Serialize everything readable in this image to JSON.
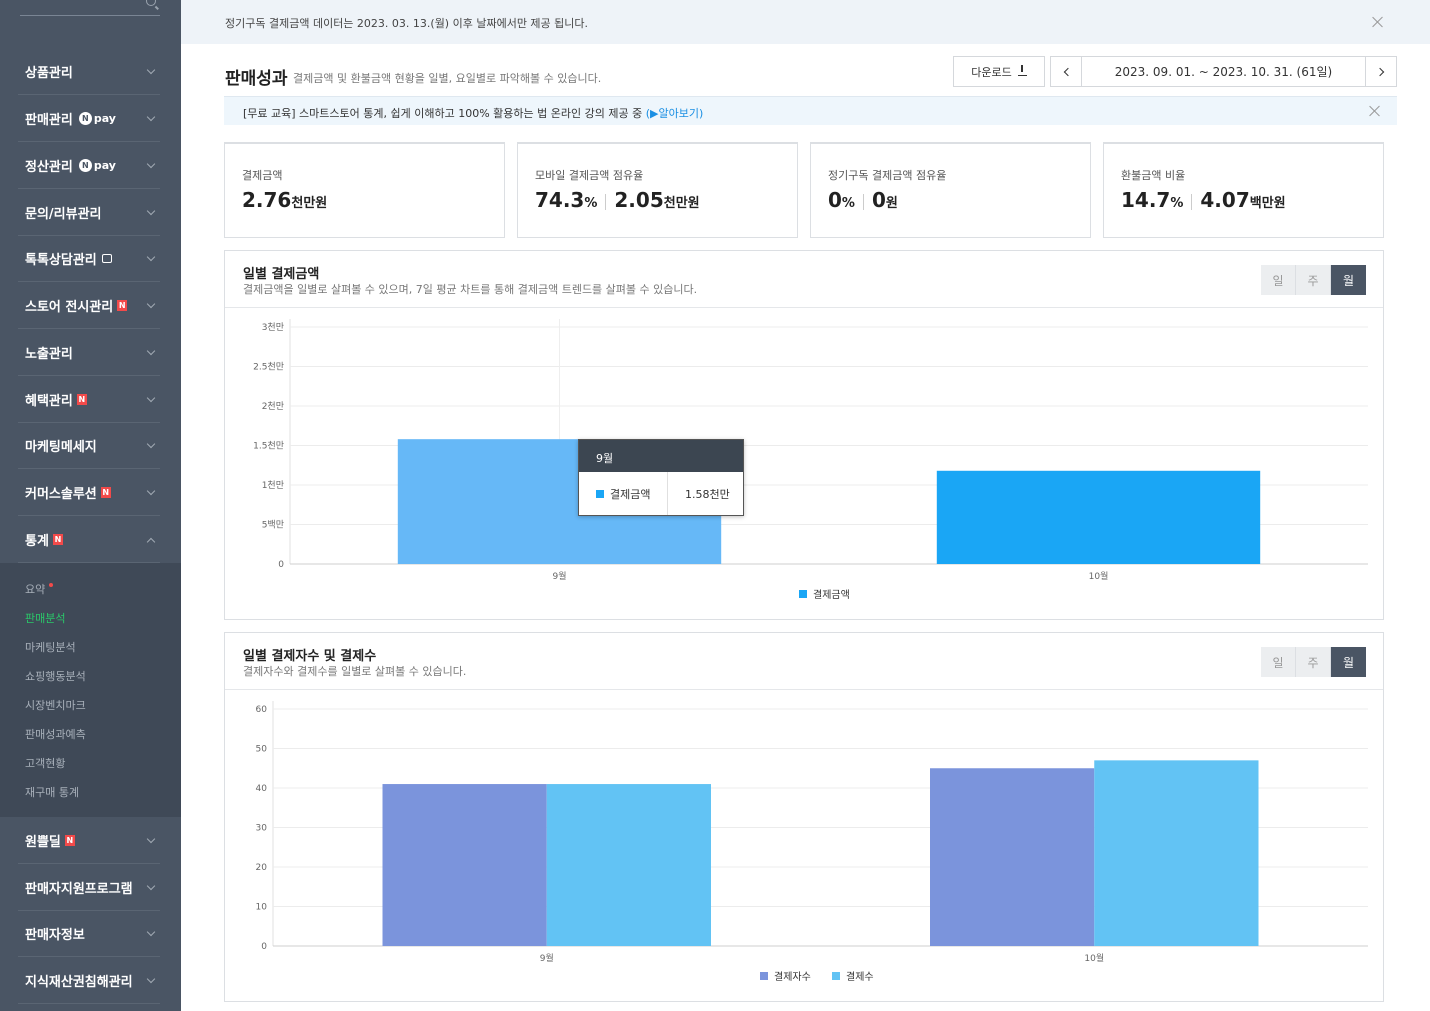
{
  "sidebar": {
    "groups": [
      {
        "label": "상품관리"
      },
      {
        "label": "판매관리",
        "npay": "pay"
      },
      {
        "label": "정산관리",
        "npay": "pay"
      },
      {
        "label": "문의/리뷰관리"
      },
      {
        "label": "톡톡상담관리"
      },
      {
        "label": "스토어 전시관리",
        "badge": "N"
      },
      {
        "label": "노출관리"
      },
      {
        "label": "혜택관리",
        "badge": "N"
      },
      {
        "label": "마케팅메세지"
      },
      {
        "label": "커머스솔루션",
        "badge": "N"
      },
      {
        "label": "통계",
        "badge": "N"
      },
      {
        "label": "원쁠딜",
        "badge": "N"
      },
      {
        "label": "판매자지원프로그램"
      },
      {
        "label": "판매자정보"
      },
      {
        "label": "지식재산권침해관리"
      }
    ],
    "npay_n": "N",
    "sub_items": [
      "요약",
      "판매분석",
      "마케팅분석",
      "쇼핑행동분석",
      "시장벤치마크",
      "판매성과예측",
      "고객현황",
      "재구매 통계"
    ]
  },
  "notice": {
    "text": "정기구독 결제금액 데이터는 2023. 03. 13.(월) 이후 날짜에서만 제공 됩니다."
  },
  "header": {
    "title": "판매성과",
    "desc": "결제금액 및 환불금액 현황을 일별, 요일별로 파악해볼 수 있습니다.",
    "download_label": "다운로드",
    "date_range": "2023. 09. 01. ~ 2023. 10. 31. (61일)"
  },
  "edu_bar": {
    "text": "[무료 교육] 스마트스토어 통계, 쉽게 이해하고 100% 활용하는 법 온라인 강의 제공 중",
    "link": "(▶알아보기)"
  },
  "kpis": [
    {
      "label": "결제금액",
      "v1": "2.76",
      "u1": "천만원"
    },
    {
      "label": "모바일 결제금액 점유율",
      "v1": "74.3",
      "u1": "%",
      "v2": "2.05",
      "u2": "천만원"
    },
    {
      "label": "정기구독 결제금액 점유율",
      "v1": "0",
      "u1": "%",
      "v2": "0",
      "u2": "원"
    },
    {
      "label": "환불금액 비율",
      "v1": "14.7",
      "u1": "%",
      "v2": "4.07",
      "u2": "백만원"
    }
  ],
  "segment": {
    "day": "일",
    "week": "주",
    "month": "월"
  },
  "panel1": {
    "title": "일별 결제금액",
    "desc": "결제금액을 일별로 살펴볼 수 있으며, 7일 평균 차트를 통해 결제금액 트렌드를 살펴볼 수 있습니다."
  },
  "panel2": {
    "title": "일별 결제자수 및 결제수",
    "desc": "결제자수와 결제수를 일별로 살펴볼 수 있습니다."
  },
  "tooltip": {
    "title": "9월",
    "series": "결제금액",
    "value": "1.58천만"
  },
  "chart_data": [
    {
      "type": "bar",
      "categories": [
        "9월",
        "10월"
      ],
      "series": [
        {
          "name": "결제금액",
          "values": [
            15800000,
            11800000
          ],
          "color": "#1aa6f5"
        }
      ],
      "ylim": [
        0,
        30000000
      ],
      "yticks": [
        0,
        5000000,
        10000000,
        15000000,
        20000000,
        25000000,
        30000000
      ],
      "ytick_labels": [
        "0",
        "5백만",
        "1천만",
        "1.5천만",
        "2천만",
        "2.5천만",
        "3천만"
      ],
      "legend": "bottom-center",
      "grid": true
    },
    {
      "type": "bar",
      "categories": [
        "9월",
        "10월"
      ],
      "series": [
        {
          "name": "결제자수",
          "values": [
            41,
            45
          ],
          "color": "#7b94dc"
        },
        {
          "name": "결제수",
          "values": [
            41,
            47
          ],
          "color": "#62c3f4"
        }
      ],
      "ylim": [
        0,
        60
      ],
      "yticks": [
        0,
        10,
        20,
        30,
        40,
        50,
        60
      ],
      "ytick_labels": [
        "0",
        "10",
        "20",
        "30",
        "40",
        "50",
        "60"
      ],
      "legend": "bottom-center",
      "grid": true
    }
  ]
}
